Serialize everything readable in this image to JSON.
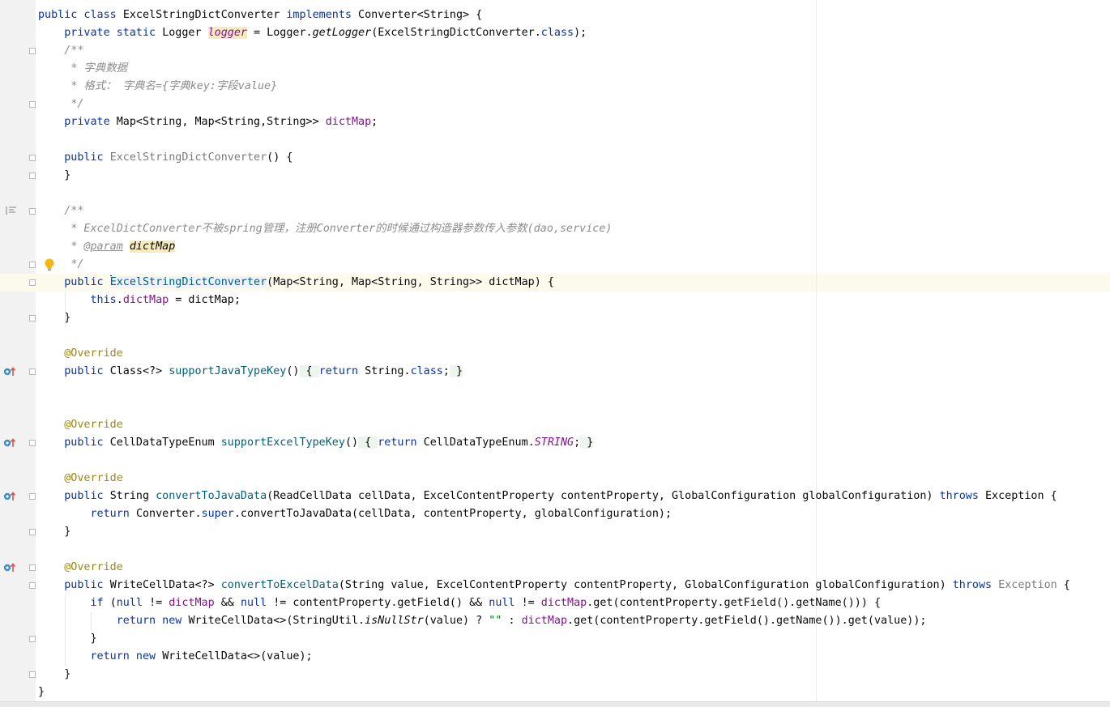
{
  "lines": [
    [
      {
        "t": "public class ",
        "c": "kw"
      },
      {
        "t": "ExcelStringDictConverter "
      },
      {
        "t": "implements ",
        "c": "kw"
      },
      {
        "t": "Converter<String> {"
      }
    ],
    [
      {
        "t": "    "
      },
      {
        "t": "private static ",
        "c": "kw"
      },
      {
        "t": "Logger "
      },
      {
        "t": "logger",
        "c": "fldi hlword"
      },
      {
        "t": " = Logger."
      },
      {
        "t": "getLogger",
        "c": "ital"
      },
      {
        "t": "(ExcelStringDictConverter."
      },
      {
        "t": "class",
        "c": "kw"
      },
      {
        "t": ");"
      }
    ],
    [
      {
        "t": "    "
      },
      {
        "t": "/**",
        "c": "cm"
      }
    ],
    [
      {
        "t": "     "
      },
      {
        "t": "* 字典数据",
        "c": "cm"
      }
    ],
    [
      {
        "t": "     "
      },
      {
        "t": "* 格式： 字典名={字典key:字段value}",
        "c": "cm"
      }
    ],
    [
      {
        "t": "     "
      },
      {
        "t": "*/",
        "c": "cm"
      }
    ],
    [
      {
        "t": "    "
      },
      {
        "t": "private ",
        "c": "kw"
      },
      {
        "t": "Map<String, Map<String,String>> "
      },
      {
        "t": "dictMap",
        "c": "fld"
      },
      {
        "t": ";"
      }
    ],
    [],
    [
      {
        "t": "    "
      },
      {
        "t": "public ",
        "c": "kw"
      },
      {
        "t": "ExcelStringDictConverter",
        "c": "gray"
      },
      {
        "t": "() {"
      }
    ],
    [
      {
        "t": "    }"
      }
    ],
    [],
    [
      {
        "t": "    "
      },
      {
        "t": "/**",
        "c": "cm"
      }
    ],
    [
      {
        "t": "     "
      },
      {
        "t": "* ExcelDictConverter不被spring管理，注册Converter的时候通过构造器参数传入参数(dao,service)",
        "c": "cm"
      }
    ],
    [
      {
        "t": "     "
      },
      {
        "t": "* ",
        "c": "cm"
      },
      {
        "t": "@param",
        "c": "cmtag"
      },
      {
        "t": " ",
        "c": "cm"
      },
      {
        "t": "dictMap",
        "c": "hlparam"
      }
    ],
    [
      {
        "t": "     "
      },
      {
        "t": "*/",
        "c": "cm"
      }
    ],
    [
      {
        "t": "    "
      },
      {
        "t": "public ",
        "c": "kw"
      },
      {
        "t": "",
        "c": "cursor"
      },
      {
        "t": "ExcelStringDictConverter",
        "c": "fn ctor-hl"
      },
      {
        "t": "(Map<String, Map<String, String>> dictMap) {"
      }
    ],
    [
      {
        "t": "        "
      },
      {
        "t": "this",
        "c": "kw"
      },
      {
        "t": "."
      },
      {
        "t": "dictMap",
        "c": "fld"
      },
      {
        "t": " = dictMap;"
      }
    ],
    [
      {
        "t": "    }"
      }
    ],
    [],
    [
      {
        "t": "    "
      },
      {
        "t": "@Override",
        "c": "ann"
      }
    ],
    [
      {
        "t": "    "
      },
      {
        "t": "public ",
        "c": "kw"
      },
      {
        "t": "Class<?> "
      },
      {
        "t": "supportJavaTypeKey",
        "c": "fn"
      },
      {
        "t": "()"
      },
      {
        "t": " { ",
        "c": "inlbox"
      },
      {
        "t": "return ",
        "c": "kw"
      },
      {
        "t": "String."
      },
      {
        "t": "class",
        "c": "kw"
      },
      {
        "t": ";"
      },
      {
        "t": " }",
        "c": "inlbox"
      }
    ],
    [],
    [],
    [
      {
        "t": "    "
      },
      {
        "t": "@Override",
        "c": "ann"
      }
    ],
    [
      {
        "t": "    "
      },
      {
        "t": "public ",
        "c": "kw"
      },
      {
        "t": "CellDataTypeEnum "
      },
      {
        "t": "supportExcelTypeKey",
        "c": "fn"
      },
      {
        "t": "()"
      },
      {
        "t": " { ",
        "c": "inlbox"
      },
      {
        "t": "return ",
        "c": "kw"
      },
      {
        "t": "CellDataTypeEnum."
      },
      {
        "t": "STRING",
        "c": "fldi"
      },
      {
        "t": ";"
      },
      {
        "t": " }",
        "c": "inlbox"
      }
    ],
    [],
    [
      {
        "t": "    "
      },
      {
        "t": "@Override",
        "c": "ann"
      }
    ],
    [
      {
        "t": "    "
      },
      {
        "t": "public ",
        "c": "kw"
      },
      {
        "t": "String "
      },
      {
        "t": "convertToJavaData",
        "c": "fn"
      },
      {
        "t": "(ReadCellData cellData, ExcelContentProperty contentProperty, GlobalConfiguration globalConfiguration) "
      },
      {
        "t": "throws ",
        "c": "kw"
      },
      {
        "t": "Exception {"
      }
    ],
    [
      {
        "t": "        "
      },
      {
        "t": "return ",
        "c": "kw"
      },
      {
        "t": "Converter."
      },
      {
        "t": "super",
        "c": "kw"
      },
      {
        "t": ".convertToJavaData(cellData, contentProperty, globalConfiguration);"
      }
    ],
    [
      {
        "t": "    }"
      }
    ],
    [],
    [
      {
        "t": "    "
      },
      {
        "t": "@Override",
        "c": "ann"
      }
    ],
    [
      {
        "t": "    "
      },
      {
        "t": "public ",
        "c": "kw"
      },
      {
        "t": "WriteCellData<?> "
      },
      {
        "t": "convertToExcelData",
        "c": "fn"
      },
      {
        "t": "(String value, ExcelContentProperty contentProperty, GlobalConfiguration globalConfiguration) "
      },
      {
        "t": "throws ",
        "c": "kw"
      },
      {
        "t": "Exception",
        "c": "gray"
      },
      {
        "t": " {"
      }
    ],
    [
      {
        "t": "        "
      },
      {
        "t": "if ",
        "c": "kw"
      },
      {
        "t": "("
      },
      {
        "t": "null ",
        "c": "kw"
      },
      {
        "t": "!= "
      },
      {
        "t": "dictMap",
        "c": "fld"
      },
      {
        "t": " && "
      },
      {
        "t": "null ",
        "c": "kw"
      },
      {
        "t": "!= contentProperty.getField() && "
      },
      {
        "t": "null ",
        "c": "kw"
      },
      {
        "t": "!= "
      },
      {
        "t": "dictMap",
        "c": "fld"
      },
      {
        "t": ".get(contentProperty.getField().getName())) {"
      }
    ],
    [
      {
        "t": "            "
      },
      {
        "t": "return new ",
        "c": "kw"
      },
      {
        "t": "WriteCellData<>(StringUtil."
      },
      {
        "t": "isNullStr",
        "c": "ital"
      },
      {
        "t": "(value) ? "
      },
      {
        "t": "\"\"",
        "c": "str"
      },
      {
        "t": " : "
      },
      {
        "t": "dictMap",
        "c": "fld"
      },
      {
        "t": ".get(contentProperty.getField().getName()).get(value));"
      }
    ],
    [
      {
        "t": "        }"
      }
    ],
    [
      {
        "t": "        "
      },
      {
        "t": "return new ",
        "c": "kw"
      },
      {
        "t": "WriteCellData<>(value);"
      }
    ],
    [
      {
        "t": "    }"
      }
    ],
    [
      {
        "t": "}"
      }
    ]
  ],
  "gutter": {
    "fold_lines": [
      2,
      5,
      8,
      9,
      11,
      14,
      15,
      17,
      20,
      24,
      27,
      29,
      31,
      32,
      35,
      37
    ],
    "implements_lines": [
      20,
      24,
      27,
      31
    ],
    "bulb_line": 14,
    "doc_toggle_line": 11
  },
  "icons": {
    "bulb": "intention-bulb-icon",
    "implements": "implements-method-icon",
    "fold": "fold-marker-icon",
    "doc": "render-doc-icon"
  }
}
